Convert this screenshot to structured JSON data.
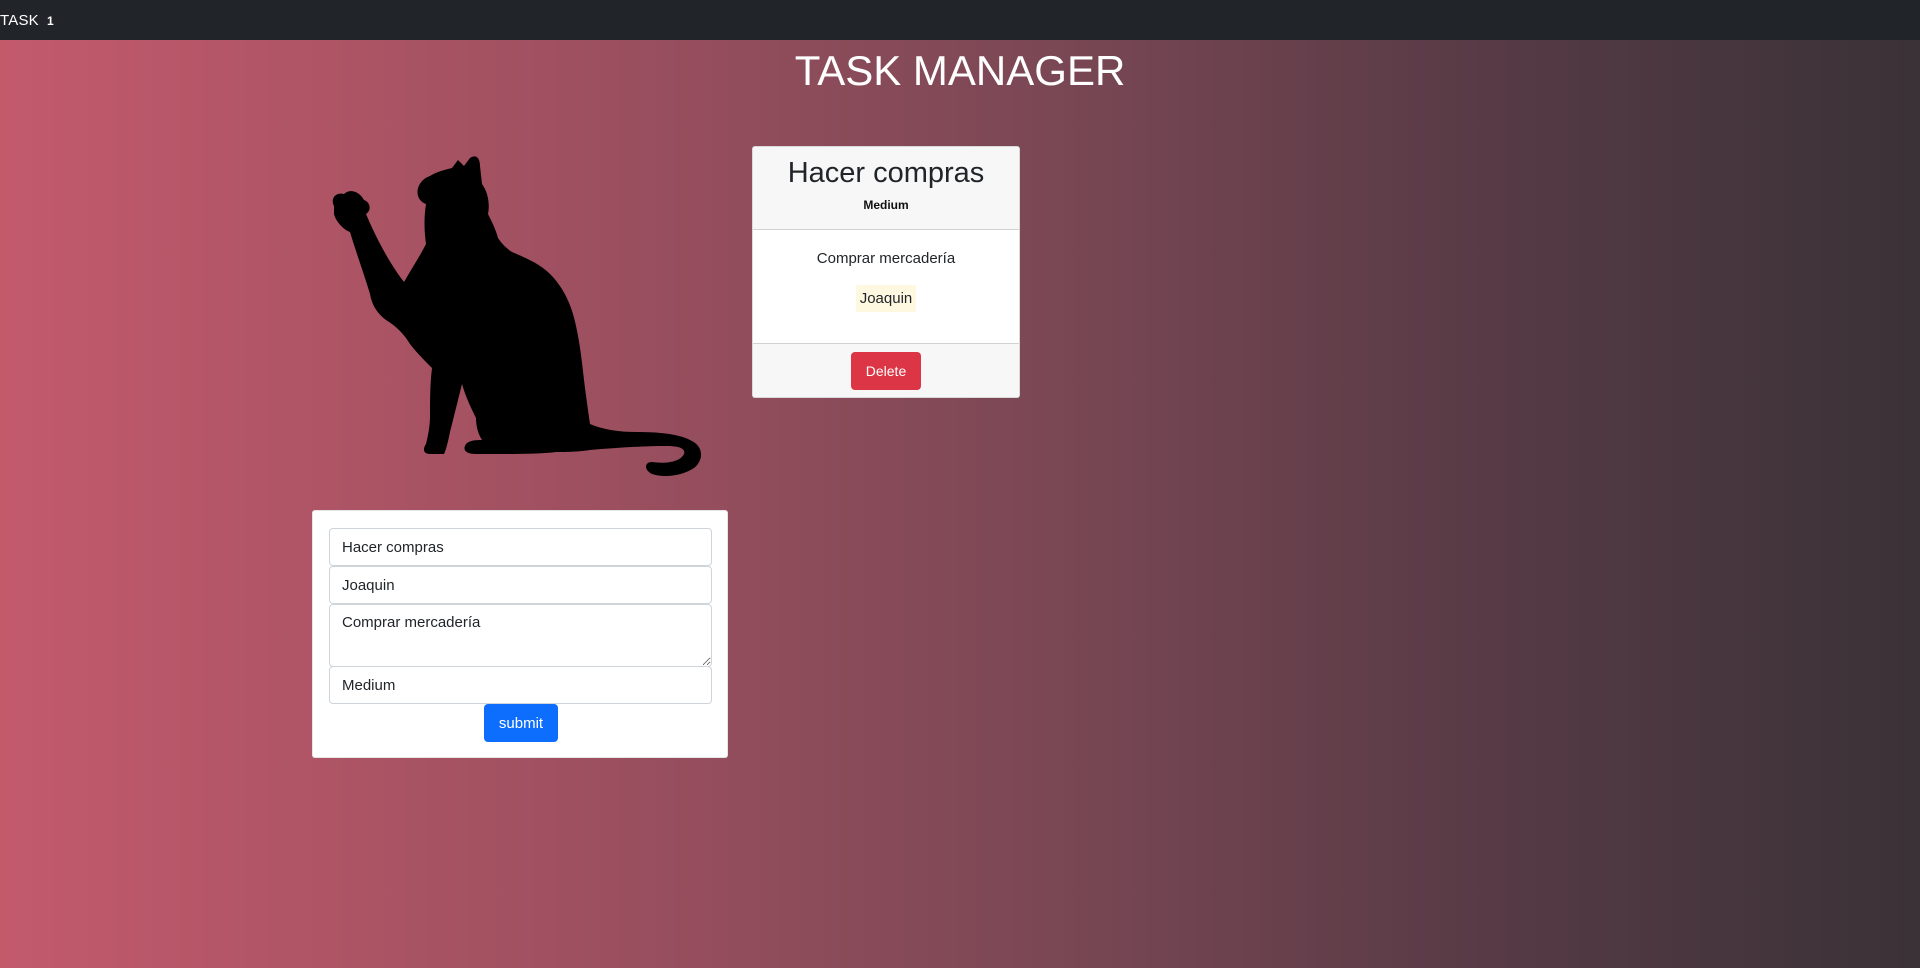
{
  "navbar": {
    "brand": "TASK",
    "count": "1"
  },
  "page": {
    "title": "TASK MANAGER"
  },
  "task_card": {
    "title": "Hacer compras",
    "priority": "Medium",
    "description": "Comprar mercadería",
    "responsible": "Joaquin",
    "delete_label": "Delete"
  },
  "form": {
    "title_value": "Hacer compras",
    "responsible_value": "Joaquin",
    "description_value": "Comprar mercadería",
    "priority_value": "Medium",
    "submit_label": "submit"
  },
  "colors": {
    "navbar": "#212529",
    "delete": "#dc3545",
    "submit": "#0d6efd",
    "bg_start": "#c25a6c",
    "bg_end": "#3a3237"
  },
  "icons": {
    "cat_image": "cat-silhouette-icon"
  }
}
